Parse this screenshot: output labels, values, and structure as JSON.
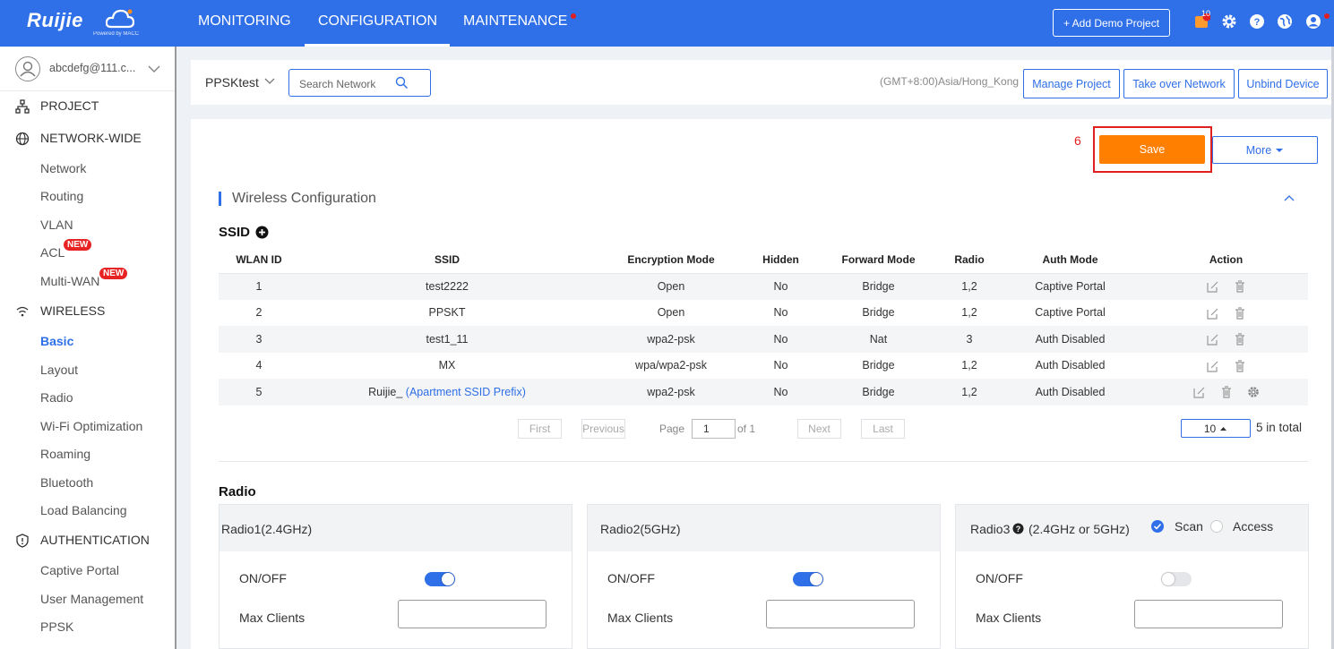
{
  "header": {
    "logo_text": "Ruijie",
    "logo_sub": "Powered by MACC",
    "nav": [
      {
        "label": "MONITORING"
      },
      {
        "label": "CONFIGURATION"
      },
      {
        "label": "MAINTENANCE"
      }
    ],
    "add_demo_label": "+ Add Demo Project",
    "notification_count": "10"
  },
  "sidebar": {
    "user_email": "abcdefg@111.c...",
    "sections": {
      "project": "PROJECT",
      "network_wide": "NETWORK-WIDE",
      "wireless": "WIRELESS",
      "authentication": "AUTHENTICATION"
    },
    "network_items": [
      "Network",
      "Routing",
      "VLAN",
      "ACL",
      "Multi-WAN"
    ],
    "new_badge": "NEW",
    "wireless_items": [
      "Basic",
      "Layout",
      "Radio",
      "Wi-Fi Optimization",
      "Roaming",
      "Bluetooth",
      "Load Balancing"
    ],
    "auth_items": [
      "Captive Portal",
      "User Management",
      "PPSK"
    ]
  },
  "project_bar": {
    "network_name": "PPSKtest",
    "search_placeholder": "Search Network",
    "timezone": "(GMT+8:00)Asia/Hong_Kong",
    "manage_project": "Manage Project",
    "take_over": "Take over Network",
    "unbind": "Unbind Device"
  },
  "toolbar": {
    "annotation_number": "6",
    "save_label": "Save",
    "more_label": "More"
  },
  "wireless": {
    "section_title": "Wireless Configuration",
    "ssid_label": "SSID",
    "columns": [
      "WLAN ID",
      "SSID",
      "Encryption Mode",
      "Hidden",
      "Forward Mode",
      "Radio",
      "Auth Mode",
      "Action"
    ],
    "rows": [
      {
        "id": "1",
        "ssid": "test2222",
        "ssid_link": "",
        "enc": "Open",
        "hidden": "No",
        "forward": "Bridge",
        "radio": "1,2",
        "auth": "Captive Portal"
      },
      {
        "id": "2",
        "ssid": "PPSKT",
        "ssid_link": "",
        "enc": "Open",
        "hidden": "No",
        "forward": "Bridge",
        "radio": "1,2",
        "auth": "Captive Portal"
      },
      {
        "id": "3",
        "ssid": "test1_11",
        "ssid_link": "",
        "enc": "wpa2-psk",
        "hidden": "No",
        "forward": "Nat",
        "radio": "3",
        "auth": "Auth Disabled"
      },
      {
        "id": "4",
        "ssid": "MX",
        "ssid_link": "",
        "enc": "wpa/wpa2-psk",
        "hidden": "No",
        "forward": "Bridge",
        "radio": "1,2",
        "auth": "Auth Disabled"
      },
      {
        "id": "5",
        "ssid": "Ruijie_ ",
        "ssid_link": "(Apartment SSID Prefix)",
        "enc": "wpa2-psk",
        "hidden": "No",
        "forward": "Bridge",
        "radio": "1,2",
        "auth": "Auth Disabled"
      }
    ],
    "pagination": {
      "first": "First",
      "previous": "Previous",
      "page_label": "Page",
      "page_value": "1",
      "of_label": "of 1",
      "next": "Next",
      "last": "Last",
      "page_size": "10",
      "total": "5 in total"
    }
  },
  "radio": {
    "label": "Radio",
    "on_off_label": "ON/OFF",
    "max_clients_label": "Max Clients",
    "cards": [
      {
        "title": "Radio1(2.4GHz)",
        "enabled": true
      },
      {
        "title": "Radio2(5GHz)",
        "enabled": true
      },
      {
        "title": "Radio3",
        "title_suffix": "(2.4GHz or 5GHz)",
        "enabled": false,
        "mode_scan": "Scan",
        "mode_access": "Access",
        "mode_selected": "Scan"
      }
    ]
  },
  "colors": {
    "primary": "#2f6fe8",
    "save_orange": "#ff7f00",
    "badge_red": "#e82323",
    "annotation_red": "#e02020"
  }
}
